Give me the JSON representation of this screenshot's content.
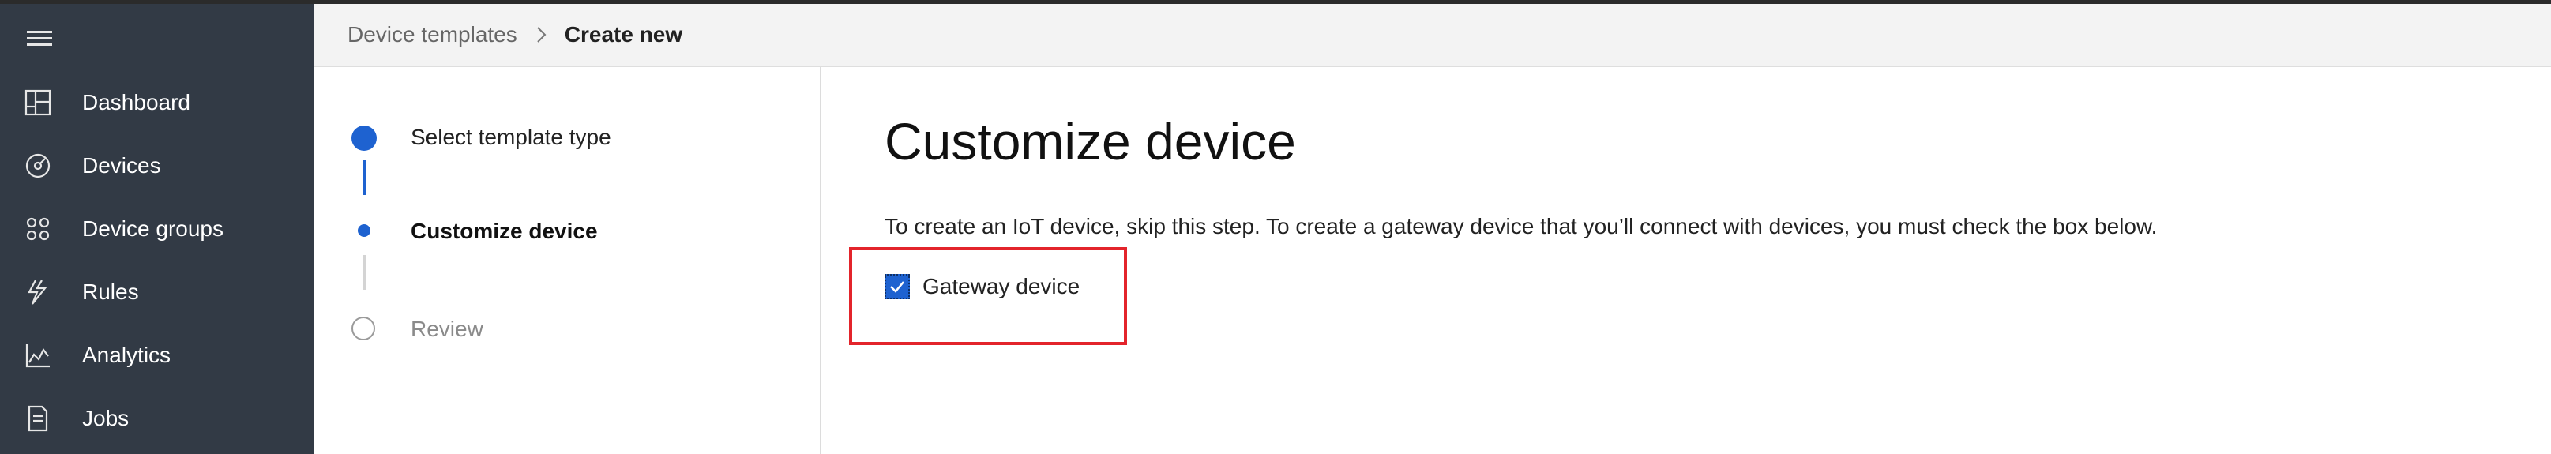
{
  "sidebar": {
    "items": [
      {
        "label": "Dashboard",
        "icon": "dashboard-icon"
      },
      {
        "label": "Devices",
        "icon": "devices-icon"
      },
      {
        "label": "Device groups",
        "icon": "device-groups-icon"
      },
      {
        "label": "Rules",
        "icon": "rules-icon"
      },
      {
        "label": "Analytics",
        "icon": "analytics-icon"
      },
      {
        "label": "Jobs",
        "icon": "jobs-icon"
      }
    ]
  },
  "breadcrumb": {
    "parent": "Device templates",
    "current": "Create new"
  },
  "stepper": {
    "steps": [
      {
        "label": "Select template type",
        "state": "completed"
      },
      {
        "label": "Customize device",
        "state": "current"
      },
      {
        "label": "Review",
        "state": "pending"
      }
    ]
  },
  "main": {
    "title": "Customize device",
    "description": "To create an IoT device, skip this step. To create a gateway device that you’ll connect with devices, you must check the box below.",
    "gateway_checkbox": {
      "label": "Gateway device",
      "checked": true
    }
  },
  "colors": {
    "sidebar_bg": "#323a45",
    "accent": "#1e62d0",
    "highlight_border": "#e3242b"
  }
}
